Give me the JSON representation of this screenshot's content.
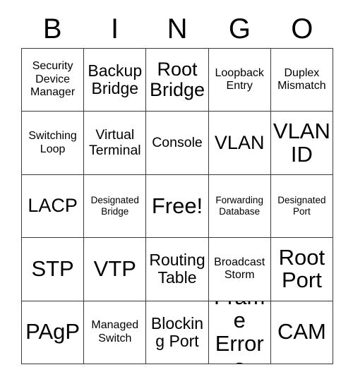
{
  "card": {
    "header_letters": [
      "B",
      "I",
      "N",
      "G",
      "O"
    ],
    "rows": [
      [
        {
          "label": "Security Device Manager",
          "size": "fs-sm",
          "free": false
        },
        {
          "label": "Backup Bridge",
          "size": "fs-lg",
          "free": false
        },
        {
          "label": "Root Bridge",
          "size": "fs-xl",
          "free": false
        },
        {
          "label": "Loopback Entry",
          "size": "fs-sm",
          "free": false
        },
        {
          "label": "Duplex Mismatch",
          "size": "fs-sm",
          "free": false
        }
      ],
      [
        {
          "label": "Switching Loop",
          "size": "fs-sm",
          "free": false
        },
        {
          "label": "Virtual Terminal",
          "size": "fs-md",
          "free": false
        },
        {
          "label": "Console",
          "size": "fs-md",
          "free": false
        },
        {
          "label": "VLAN",
          "size": "fs-xl",
          "free": false
        },
        {
          "label": "VLAN ID",
          "size": "fs-xxl",
          "free": false
        }
      ],
      [
        {
          "label": "LACP",
          "size": "fs-xl",
          "free": false
        },
        {
          "label": "Designated Bridge",
          "size": "fs-xs",
          "free": false
        },
        {
          "label": "Free!",
          "size": "fs-xxl",
          "free": true
        },
        {
          "label": "Forwarding Database",
          "size": "fs-xs",
          "free": false
        },
        {
          "label": "Designated Port",
          "size": "fs-xs",
          "free": false
        }
      ],
      [
        {
          "label": "STP",
          "size": "fs-xxl",
          "free": false
        },
        {
          "label": "VTP",
          "size": "fs-xxl",
          "free": false
        },
        {
          "label": "Routing Table",
          "size": "fs-lg",
          "free": false
        },
        {
          "label": "Broadcast Storm",
          "size": "fs-sm",
          "free": false
        },
        {
          "label": "Root Port",
          "size": "fs-xxl",
          "free": false
        }
      ],
      [
        {
          "label": "PAgP",
          "size": "fs-xxl",
          "free": false
        },
        {
          "label": "Managed Switch",
          "size": "fs-sm",
          "free": false
        },
        {
          "label": "Blocking Port",
          "size": "fs-lg",
          "free": false
        },
        {
          "label": "Frame Errors",
          "size": "fs-xxl",
          "free": false
        },
        {
          "label": "CAM",
          "size": "fs-xxl",
          "free": false
        }
      ]
    ]
  },
  "colors": {
    "background": "#ffffff",
    "text": "#000000",
    "grid_line": "#3a3a3a"
  }
}
